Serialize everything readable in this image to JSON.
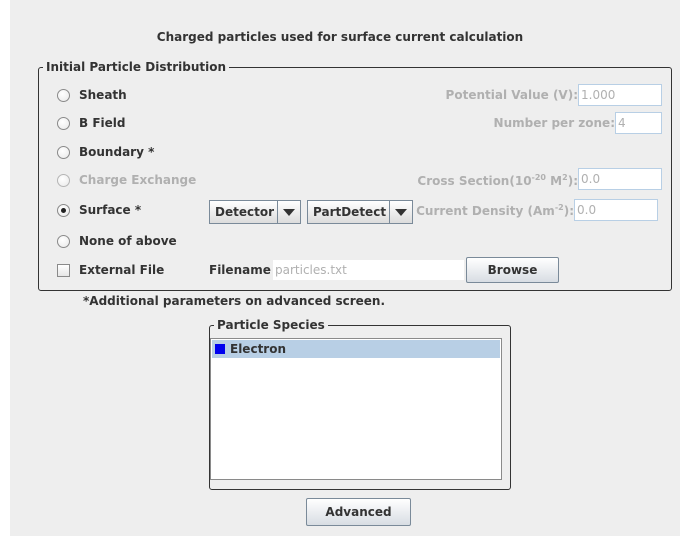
{
  "title": "Charged particles used for surface current calculation",
  "distribution": {
    "legend": "Initial Particle Distribution",
    "options": [
      {
        "label": "Sheath",
        "selected": false,
        "enabled": true
      },
      {
        "label": "B Field",
        "selected": false,
        "enabled": true
      },
      {
        "label": "Boundary *",
        "selected": false,
        "enabled": true
      },
      {
        "label": "Charge Exchange",
        "selected": false,
        "enabled": false
      },
      {
        "label": "Surface *",
        "selected": true,
        "enabled": true
      },
      {
        "label": "None of above",
        "selected": false,
        "enabled": true
      }
    ],
    "external_file": {
      "label": "External File",
      "checked": false
    },
    "potential": {
      "label": "Potential Value (V):",
      "value": "1.000"
    },
    "number_per_zone": {
      "label": "Number per zone:",
      "value": "4"
    },
    "cross_section": {
      "label_pre": "Cross Section(10",
      "label_sup": "-20",
      "label_mid": " M",
      "label_sup2": "2",
      "label_post": "):",
      "value": "0.0"
    },
    "current_density": {
      "label_pre": "Current Density (Am",
      "label_sup": "-2",
      "label_post": "):",
      "value": "0.0"
    },
    "surface_combo1": "Detector",
    "surface_combo2": "PartDetect",
    "filename": {
      "label": "Filename:",
      "value": "particles.txt"
    },
    "browse_label": "Browse"
  },
  "note": "*Additional parameters on advanced screen.",
  "species": {
    "legend": "Particle Species",
    "items": [
      {
        "label": "Electron",
        "color": "#0000ee",
        "selected": true
      }
    ]
  },
  "advanced_label": "Advanced",
  "colors": {
    "panel": "#eeeeee",
    "selection": "#b8cfe5",
    "disabled_text": "#b0b0b0"
  }
}
